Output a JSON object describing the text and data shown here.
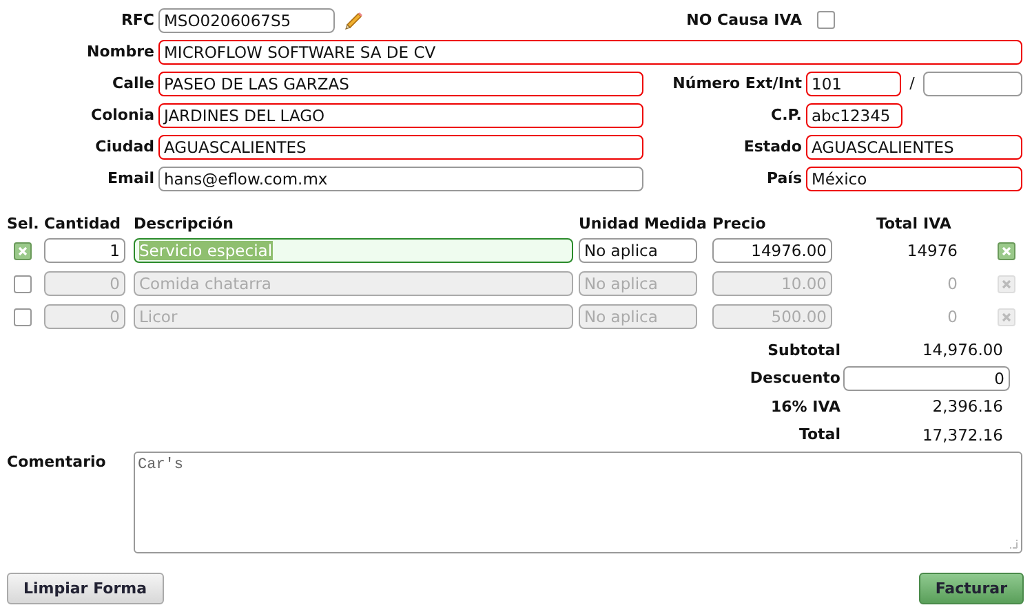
{
  "customer": {
    "rfc": {
      "label": "RFC",
      "value": "MSO0206067S5"
    },
    "no_causa_iva": {
      "label": "NO Causa IVA",
      "checked": false
    },
    "nombre": {
      "label": "Nombre",
      "value": "MICROFLOW SOFTWARE SA DE CV",
      "invalid": true
    },
    "calle": {
      "label": "Calle",
      "value": "PASEO DE LAS GARZAS",
      "invalid": true
    },
    "numero": {
      "label": "Número Ext/Int",
      "ext": "101",
      "ext_invalid": true,
      "separator": "/",
      "int_invalid": false
    },
    "colonia": {
      "label": "Colonia",
      "value": "JARDINES DEL LAGO",
      "invalid": true
    },
    "cp": {
      "label": "C.P.",
      "value": "abc12345",
      "invalid": true
    },
    "ciudad": {
      "label": "Ciudad",
      "value": "AGUASCALIENTES",
      "invalid": true
    },
    "estado": {
      "label": "Estado",
      "value": "AGUASCALIENTES",
      "invalid": true
    },
    "email": {
      "label": "Email",
      "value": "hans@eflow.com.mx",
      "invalid": false
    },
    "pais": {
      "label": "País",
      "value": "México",
      "invalid": true
    }
  },
  "items": {
    "columns": [
      "Sel.",
      "Cantidad",
      "Descripción",
      "Unidad Medida",
      "Precio",
      "Total",
      "IVA"
    ],
    "rows": [
      {
        "selected": true,
        "quantity": "1",
        "description": "Servicio especial",
        "focused": true,
        "unit": "No aplica",
        "price": "14976.00",
        "total": "14976",
        "iva": true
      },
      {
        "selected": false,
        "quantity": "0",
        "description": "Comida chatarra",
        "focused": false,
        "unit": "No aplica",
        "price": "10.00",
        "total": "0",
        "iva": true
      },
      {
        "selected": false,
        "quantity": "0",
        "description": "Licor",
        "focused": false,
        "unit": "No aplica",
        "price": "500.00",
        "total": "0",
        "iva": true
      }
    ]
  },
  "totals": [
    {
      "kind": "text",
      "label": "Subtotal",
      "value": "14,976.00"
    },
    {
      "kind": "field",
      "label": "Descuento",
      "value": "0"
    },
    {
      "kind": "text",
      "label": "16% IVA",
      "value": "2,396.16"
    },
    {
      "kind": "text",
      "label": "Total",
      "value": "17,372.16"
    }
  ],
  "comment": {
    "label": "Comentario",
    "value": "Car's"
  },
  "buttons": [
    {
      "kind": "secondary",
      "label": "Limpiar Forma"
    },
    {
      "kind": "primary",
      "label": "Facturar"
    }
  ]
}
